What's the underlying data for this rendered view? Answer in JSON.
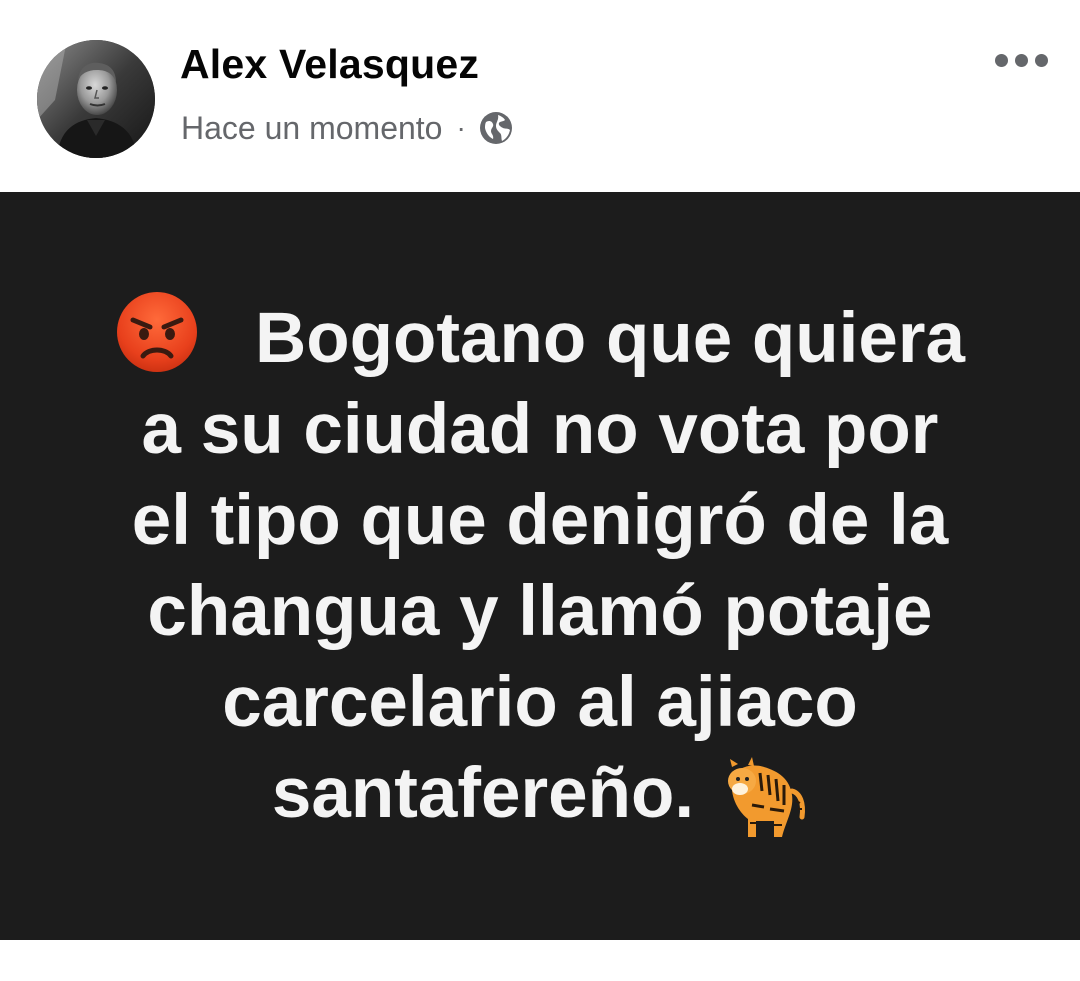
{
  "post": {
    "author_name": "Alex Velasquez",
    "timestamp": "Hace un momento",
    "separator": "·",
    "privacy_icon": "globe-icon",
    "menu_icon": "more-options-icon"
  },
  "card": {
    "background_color": "#1c1c1c",
    "text_color": "#f4f4f4",
    "leading_emoji": "angry-face-emoji",
    "trailing_emoji": "tiger-emoji",
    "lines": [
      "Bogotano que quiera",
      "a su ciudad no vota por",
      "el tipo que denigró de la",
      "changua y llamó potaje",
      "carcelario al ajiaco",
      "santafereño."
    ]
  }
}
